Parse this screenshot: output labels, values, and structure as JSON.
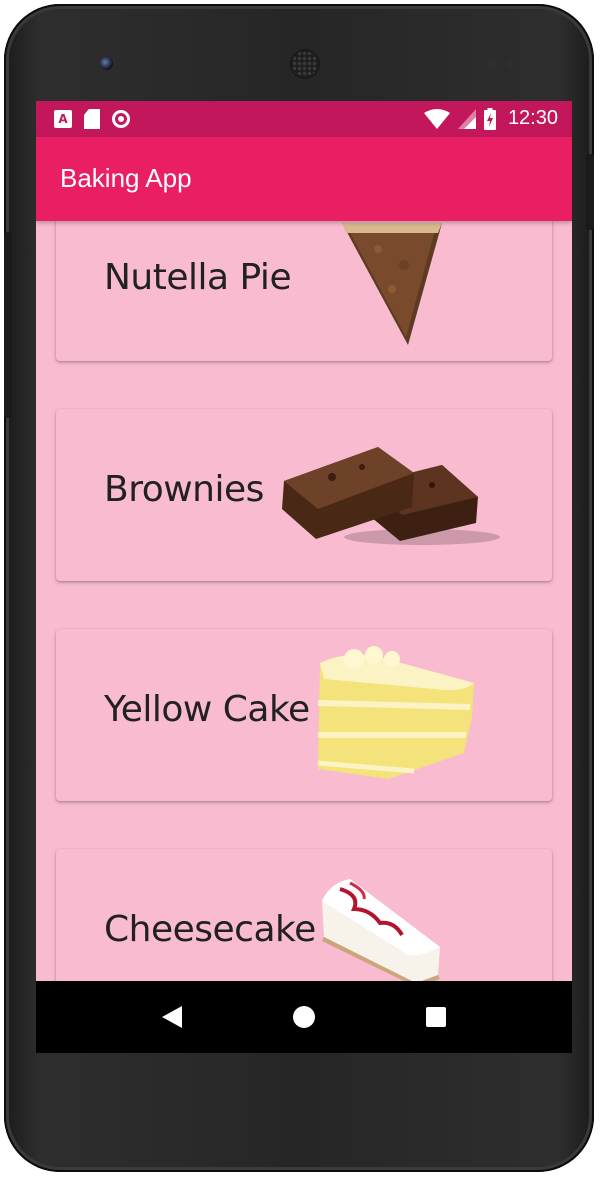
{
  "status_bar": {
    "time": "12:30",
    "left_icons": [
      "a-notification-icon",
      "sd-card-icon",
      "record-icon"
    ],
    "right_icons": [
      "wifi-icon",
      "signal-icon",
      "battery-charging-icon"
    ]
  },
  "app_bar": {
    "title": "Baking App"
  },
  "recipes": [
    {
      "name": "Nutella Pie",
      "image": "nutella-pie-slice"
    },
    {
      "name": "Brownies",
      "image": "brownies"
    },
    {
      "name": "Yellow Cake",
      "image": "yellow-cake-slice"
    },
    {
      "name": "Cheesecake",
      "image": "cheesecake-slice"
    }
  ],
  "nav_bar": {
    "buttons": [
      "back",
      "home",
      "recents"
    ]
  },
  "colors": {
    "primary": "#e91e63",
    "primary_dark": "#c2185b",
    "background": "#f8bbd0"
  }
}
